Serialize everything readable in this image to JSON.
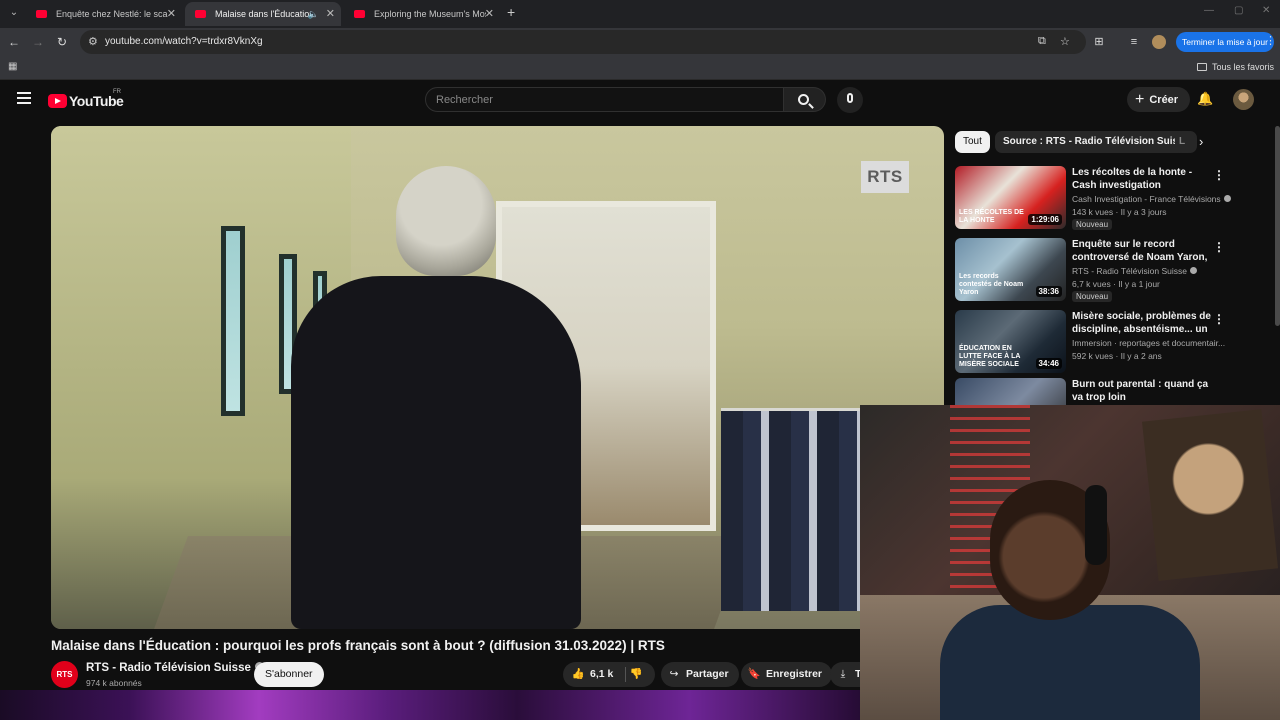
{
  "browser": {
    "tabs": [
      {
        "title": "Enquête chez Nestlé: le scandale",
        "active": false
      },
      {
        "title": "Malaise dans l'Éducation : pourquoi",
        "active": true
      },
      {
        "title": "Exploring the Museum's Most Myst",
        "active": false
      }
    ],
    "url": "youtube.com/watch?v=trdxr8VknXg",
    "update_button": "Terminer la mise à jour",
    "bookmarks_all": "Tous les favoris"
  },
  "youtube": {
    "logo_text": "YouTube",
    "country_code": "FR",
    "search_placeholder": "Rechercher",
    "create_label": "Créer"
  },
  "video": {
    "watermark": "RTS",
    "title": "Malaise dans l'Éducation : pourquoi les profs français sont à bout ? (diffusion 31.03.2022) | RTS",
    "channel": "RTS - Radio Télévision Suisse",
    "channel_avatar_text": "RTS",
    "subscribers": "974 k abonnés",
    "subscribe_label": "S'abonner",
    "likes": "6,1 k",
    "share_label": "Partager",
    "save_label": "Enregistrer",
    "download_label_partial": "T"
  },
  "sidebar": {
    "chips": [
      {
        "label": "Tout",
        "active": true
      },
      {
        "label": "Source : RTS - Radio Télévision Suisse",
        "active": false
      },
      {
        "label": "L",
        "active": false
      }
    ],
    "recommendations": [
      {
        "title": "Les récoltes de la honte - Cash investigation",
        "channel": "Cash Investigation - France Télévisions",
        "meta": "143 k vues · Il y a 3 jours",
        "badge": "Nouveau",
        "duration": "1:29:06",
        "thumb_text": "LES RÉCOLTES DE LA HONTE"
      },
      {
        "title": "Enquête sur le record controversé de Noam Yaron, ...",
        "channel": "RTS - Radio Télévision Suisse",
        "meta": "6,7 k vues · Il y a 1 jour",
        "badge": "Nouveau",
        "duration": "38:36",
        "thumb_text": "Les records contestés de Noam Yaron"
      },
      {
        "title": "Misère sociale, problèmes de discipline, absentéisme... un ...",
        "channel": "Immersion · reportages et documentair...",
        "meta": "592 k vues · Il y a 2 ans",
        "badge": "",
        "duration": "34:46",
        "thumb_text": "ÉDUCATION EN LUTTE FACE À LA MISÈRE SOCIALE"
      },
      {
        "title": "Burn out parental : quand ça va trop loin",
        "channel": "",
        "meta": "",
        "badge": "",
        "duration": "",
        "thumb_text": ""
      }
    ]
  }
}
